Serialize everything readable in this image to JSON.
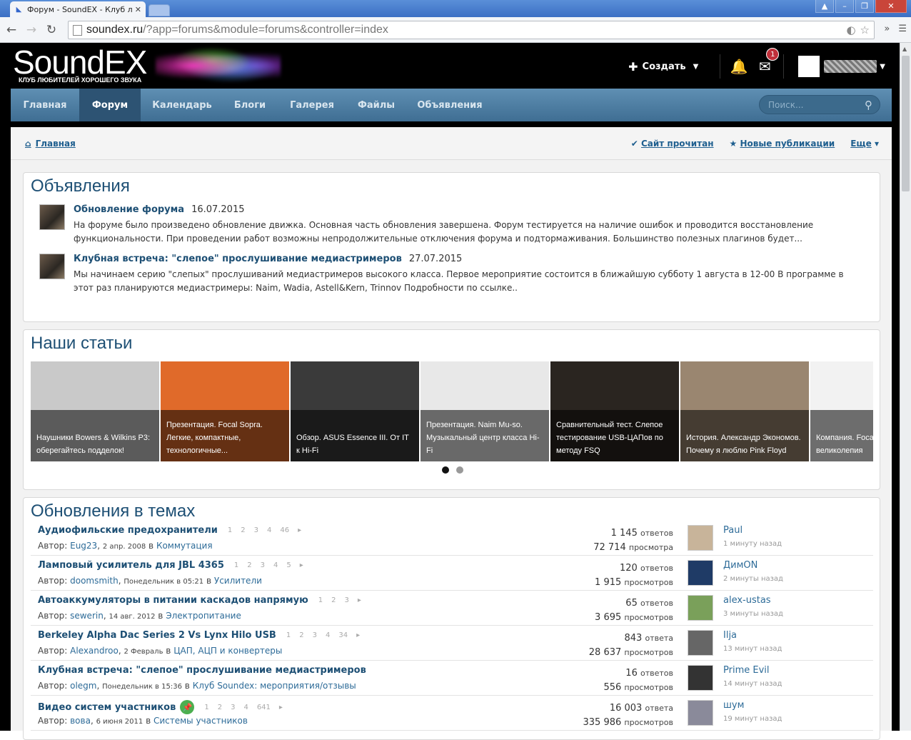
{
  "browser": {
    "tab_title": "Форум - SoundEX - Клуб лю",
    "url_host": "soundex.ru",
    "url_path": "/?app=forums&module=forums&controller=index"
  },
  "header": {
    "brand": "SoundEX",
    "tagline": "КЛУБ ЛЮБИТЕЛЕЙ ХОРОШЕГО ЗВУКА",
    "create_label": "Создать",
    "messages_badge": "1"
  },
  "nav": {
    "items": [
      "Главная",
      "Форум",
      "Календарь",
      "Блоги",
      "Галерея",
      "Файлы",
      "Объявления"
    ],
    "active": "Форум",
    "search_placeholder": "Поиск..."
  },
  "breadcrumb": {
    "home": "Главная",
    "mark_read": "Сайт прочитан",
    "new_posts": "Новые публикации",
    "more": "Еще"
  },
  "announcements": {
    "title": "Объявления",
    "items": [
      {
        "title": "Обновление форума",
        "date": "16.07.2015",
        "text": "На форуме было произведено обновление движка. Основная часть обновления завершена. Форум тестируется на наличие ошибок и проводится восстановление функциональности. При проведении работ возможны непродолжительные отключения форума и подтормаживания.  Большинство полезных плагинов будет..."
      },
      {
        "title": "Клубная встреча: \"слепое\" прослушивание медиастримеров",
        "date": "27.07.2015",
        "text": "Мы начинаем серию \"слепых\" прослушиваний медиастримеров высокого класса.  Первое мероприятие состоится в ближайшую субботу 1 августа в 12-00  В программе  в этот раз планируются медиастримеры: Naim, Wadia, Astell&Kern, Trinnov Подробности по ссылке.."
      }
    ]
  },
  "articles": {
    "title": "Наши статьи",
    "slides": [
      {
        "caption": "Наушники Bowers & Wilkins P3: оберегайтесь подделок!",
        "bg": "#c9c9c9"
      },
      {
        "caption": "Презентация. Focal Sopra. Легкие, компактные, технологичные...",
        "bg": "#e06a2a"
      },
      {
        "caption": "Обзор. ASUS Essence III. От IT к Hi-Fi",
        "bg": "#3a3a3a"
      },
      {
        "caption": "Презентация. Naim Mu-so. Музыкальный центр класса Hi-Fi",
        "bg": "#e8e8e8"
      },
      {
        "caption": "Сравнительный тест. Слепое тестирование USB-ЦАПов по методу FSQ",
        "bg": "#2a2520"
      },
      {
        "caption": "История. Александр Экономов. Почему я люблю Pink Floyd",
        "bg": "#9a8670"
      },
      {
        "caption": "Компания. Focal в фокусе великолепия",
        "bg": "#f2f2f2"
      }
    ],
    "dots": 2,
    "active_dot": 1
  },
  "topics": {
    "title": "Обновления в темах",
    "author_prefix": "Автор:",
    "in_word": "в",
    "rows": [
      {
        "title": "Аудиофильские предохранители",
        "pages": [
          "1",
          "2",
          "3",
          "4",
          "46"
        ],
        "author": "Eug23",
        "date": "2 апр. 2008",
        "forum": "Коммутация",
        "replies": "1 145",
        "replies_word": "ответов",
        "views": "72 714",
        "views_word": "просмотра",
        "last_user": "Paul",
        "last_time": "1 минуту назад",
        "pinned": false
      },
      {
        "title": "Ламповый усилитель для JBL 4365",
        "pages": [
          "1",
          "2",
          "3",
          "4",
          "5"
        ],
        "author": "doomsmith",
        "date": "Понедельник в 05:21",
        "forum": "Усилители",
        "replies": "120",
        "replies_word": "ответов",
        "views": "1 915",
        "views_word": "просмотров",
        "last_user": "ДимON",
        "last_time": "2 минуты назад",
        "pinned": false
      },
      {
        "title": "Автоаккумуляторы в питании каскадов напрямую",
        "pages": [
          "1",
          "2",
          "3"
        ],
        "author": "sewerin",
        "date": "14 авг. 2012",
        "forum": "Электропитание",
        "replies": "65",
        "replies_word": "ответов",
        "views": "3 695",
        "views_word": "просмотров",
        "last_user": "alex-ustas",
        "last_time": "3 минуты назад",
        "pinned": false
      },
      {
        "title": "Berkeley Alpha Dac Series 2 Vs Lynx Hilo USB",
        "pages": [
          "1",
          "2",
          "3",
          "4",
          "34"
        ],
        "author": "Alexandroo",
        "date": "2 Февраль",
        "forum": "ЦАП, АЦП и конвертеры",
        "replies": "843",
        "replies_word": "ответа",
        "views": "28 637",
        "views_word": "просмотров",
        "last_user": "Ilja",
        "last_time": "13 минут назад",
        "pinned": false
      },
      {
        "title": "Клубная встреча: \"слепое\" прослушивание медиастримеров",
        "pages": [],
        "author": "olegm",
        "date": "Понедельник в 15:36",
        "forum": "Клуб Soundex: мероприятия/отзывы",
        "replies": "16",
        "replies_word": "ответов",
        "views": "556",
        "views_word": "просмотров",
        "last_user": "Prime Evil",
        "last_time": "14 минут назад",
        "pinned": false
      },
      {
        "title": "Видео систем участников",
        "pages": [
          "1",
          "2",
          "3",
          "4",
          "641"
        ],
        "author": "вова",
        "date": "6 июня 2011",
        "forum": "Системы участников",
        "replies": "16 003",
        "replies_word": "ответа",
        "views": "335 986",
        "views_word": "просмотров",
        "last_user": "шум",
        "last_time": "19 минут назад",
        "pinned": true
      }
    ]
  },
  "colors": {
    "accent": "#1d4f74",
    "nav": "#4f7fa5",
    "link": "#2d6b98"
  }
}
